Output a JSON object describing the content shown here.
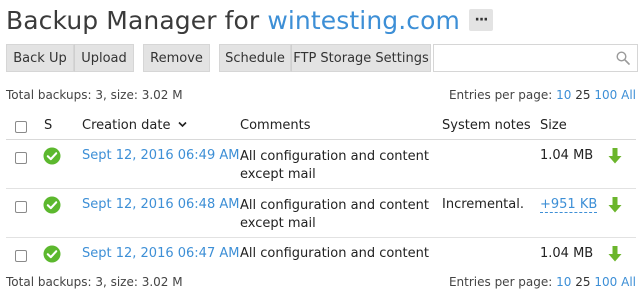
{
  "header": {
    "title_prefix": "Backup Manager for ",
    "domain": "wintesting.com",
    "more_label": "···"
  },
  "toolbar": {
    "back_up": "Back Up",
    "upload": "Upload",
    "remove": "Remove",
    "schedule": "Schedule",
    "ftp_settings": "FTP Storage Settings"
  },
  "search": {
    "placeholder": "",
    "icon": "search-icon"
  },
  "summary": {
    "top": "Total backups: 3, size: 3.02 M",
    "bottom": "Total backups: 3, size: 3.02 M"
  },
  "per_page": {
    "label": "Entries per page:",
    "options": [
      "10",
      "25",
      "100",
      "All"
    ],
    "current": "25"
  },
  "table": {
    "columns": {
      "status": "S",
      "creation_date": "Creation date",
      "comments": "Comments",
      "system_notes": "System notes",
      "size": "Size"
    },
    "rows": [
      {
        "date": "Sept 12, 2016 06:49 AM",
        "comment": "All configuration and content except mail",
        "notes": "",
        "size": "1.04 MB",
        "size_link": false
      },
      {
        "date": "Sept 12, 2016 06:48 AM",
        "comment": "All configuration and content except mail",
        "notes": "Incremental.",
        "size": "+951 KB",
        "size_link": true
      },
      {
        "date": "Sept 12, 2016 06:47 AM",
        "comment": "All configuration and content",
        "notes": "",
        "size": "1.04 MB",
        "size_link": false
      }
    ]
  },
  "colors": {
    "link": "#3d8fd6",
    "success": "#5cb82e",
    "download": "#6bb52c",
    "button_bg": "#e3e3e3"
  }
}
